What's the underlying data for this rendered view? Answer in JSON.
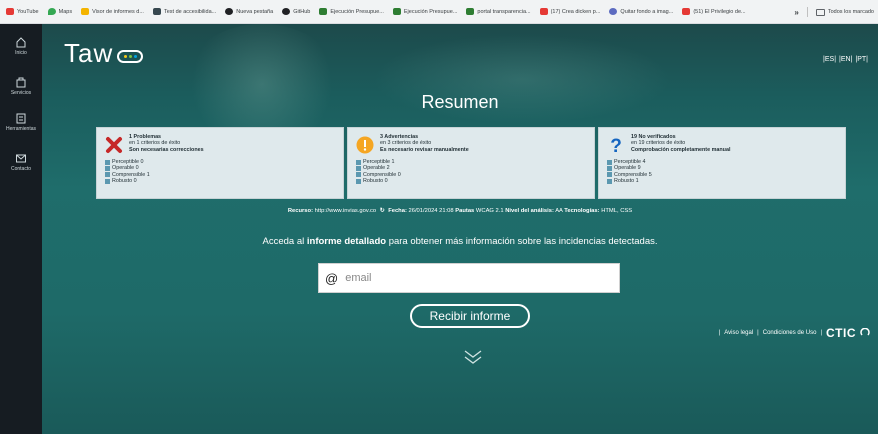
{
  "bookmarks": {
    "items": [
      {
        "label": "YouTube",
        "icon": "youtube-icon",
        "color": "#e53935"
      },
      {
        "label": "Maps",
        "icon": "maps-icon",
        "color": "#34a853"
      },
      {
        "label": "Visor de informes d...",
        "icon": "report-icon",
        "color": "#f4b400"
      },
      {
        "label": "Test de accesibilida...",
        "icon": "test-icon",
        "color": "#37474f"
      },
      {
        "label": "Nueva pestaña",
        "icon": "tab-icon",
        "color": "#202124"
      },
      {
        "label": "GitHub",
        "icon": "github-icon",
        "color": "#202124"
      },
      {
        "label": "Ejecución Presupue...",
        "icon": "budget-icon",
        "color": "#2e7d32"
      },
      {
        "label": "Ejecución Presupue...",
        "icon": "budget-icon",
        "color": "#2e7d32"
      },
      {
        "label": "portal transparencia...",
        "icon": "portal-icon",
        "color": "#2e7d32"
      },
      {
        "label": "(17) Crea dicken p...",
        "icon": "youtube-icon",
        "color": "#e53935"
      },
      {
        "label": "Quitar fondo a imag...",
        "icon": "remove-bg-icon",
        "color": "#5c6bc0"
      },
      {
        "label": "(51) El Privilegio de...",
        "icon": "youtube-icon",
        "color": "#e53935"
      }
    ],
    "more": "»",
    "all_folder": "Todos los marcado"
  },
  "sidebar": {
    "items": [
      {
        "label": "Inicio",
        "icon": "home-icon"
      },
      {
        "label": "Servicios",
        "icon": "services-icon"
      },
      {
        "label": "Herramientas",
        "icon": "tools-icon"
      },
      {
        "label": "Contacto",
        "icon": "contact-icon"
      }
    ]
  },
  "header": {
    "logo_text": "Taw",
    "languages": [
      "|ES|",
      "|EN|",
      "|PT|"
    ]
  },
  "main": {
    "title": "Resumen",
    "cards": [
      {
        "icon": "error-x-icon",
        "heading": "1 Problemas",
        "subheading": "en 1 criterios de éxito",
        "note": "Son necesarias correcciones",
        "items": [
          "Perceptible 0",
          "Operable 0",
          "Comprensible 1",
          "Robusto 0"
        ]
      },
      {
        "icon": "warning-icon",
        "heading": "3 Advertencias",
        "subheading": "en 3 criterios de éxito",
        "note": "Es necesario revisar manualmente",
        "items": [
          "Perceptible 1",
          "Operable 2",
          "Comprensible 0",
          "Robusto 0"
        ]
      },
      {
        "icon": "question-icon",
        "heading": "19 No verificados",
        "subheading": "en 19 criterios de éxito",
        "note": "Comprobación completamente manual",
        "items": [
          "Perceptible 4",
          "Operable 9",
          "Comprensible 5",
          "Robusto 1"
        ]
      }
    ],
    "meta": {
      "resource_label": "Recurso:",
      "resource_value": "http://www.invias.gov.co",
      "date_label": "Fecha:",
      "date_value": "26/01/2024 21:08",
      "guidelines_label": "Pautas",
      "guidelines_value": "WCAG 2.1",
      "level_label": "Nivel del análisis:",
      "level_value": "AA",
      "tech_label": "Tecnologías:",
      "tech_value": "HTML, CSS"
    },
    "access": {
      "prefix": "Acceda al ",
      "bold": "informe detallado",
      "suffix": " para obtener más información sobre las incidencias detectadas."
    },
    "email": {
      "at": "@",
      "placeholder": "email",
      "value": ""
    },
    "receive_button": "Recibir informe"
  },
  "footer": {
    "legal": "Aviso legal",
    "terms": "Condiciones de Uso",
    "brand": "CTIC"
  },
  "colors": {
    "bg_teal": "#1f6d6b",
    "sidebar": "#161c22",
    "card_bg": "#dfe9ec",
    "error": "#c62828",
    "warning": "#f5a623",
    "question": "#1565c0",
    "list_square": "#5b98b0"
  }
}
